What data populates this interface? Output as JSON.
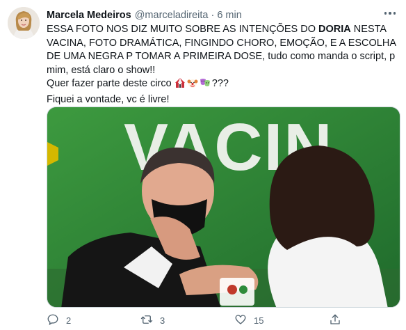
{
  "tweet": {
    "author_name": "Marcela Medeiros",
    "author_handle": "@marceladireita",
    "separator": "·",
    "timestamp": "6 min",
    "text": {
      "line1_a": "ESSA FOTO NOS DIZ MUITO SOBRE AS INTENÇÕES DO ",
      "line1_bold": "DORIA",
      "line1_b": " NESTA VACINA, FOTO DRAMÁTICA, FINGINDO CHORO, EMOÇÃO, E A ESCOLHA DE UMA NEGRA P TOMAR A PRIMEIRA DOSE, tudo como manda o script, p mim, está claro o show!!",
      "line2": "Quer fazer parte deste circo ",
      "line2_end": "???",
      "line3": "Fiquei a vontade, vc é livre!"
    },
    "emojis": [
      "circus-tent-icon",
      "clown-face-icon",
      "performing-arts-icon"
    ],
    "image_text": "VACIN",
    "counts": {
      "replies": "2",
      "retweets": "3",
      "likes": "15"
    },
    "colors": {
      "text_secondary": "#536471",
      "wall_green": "#2e8b3a",
      "banner_yellow": "#d4b800"
    }
  }
}
